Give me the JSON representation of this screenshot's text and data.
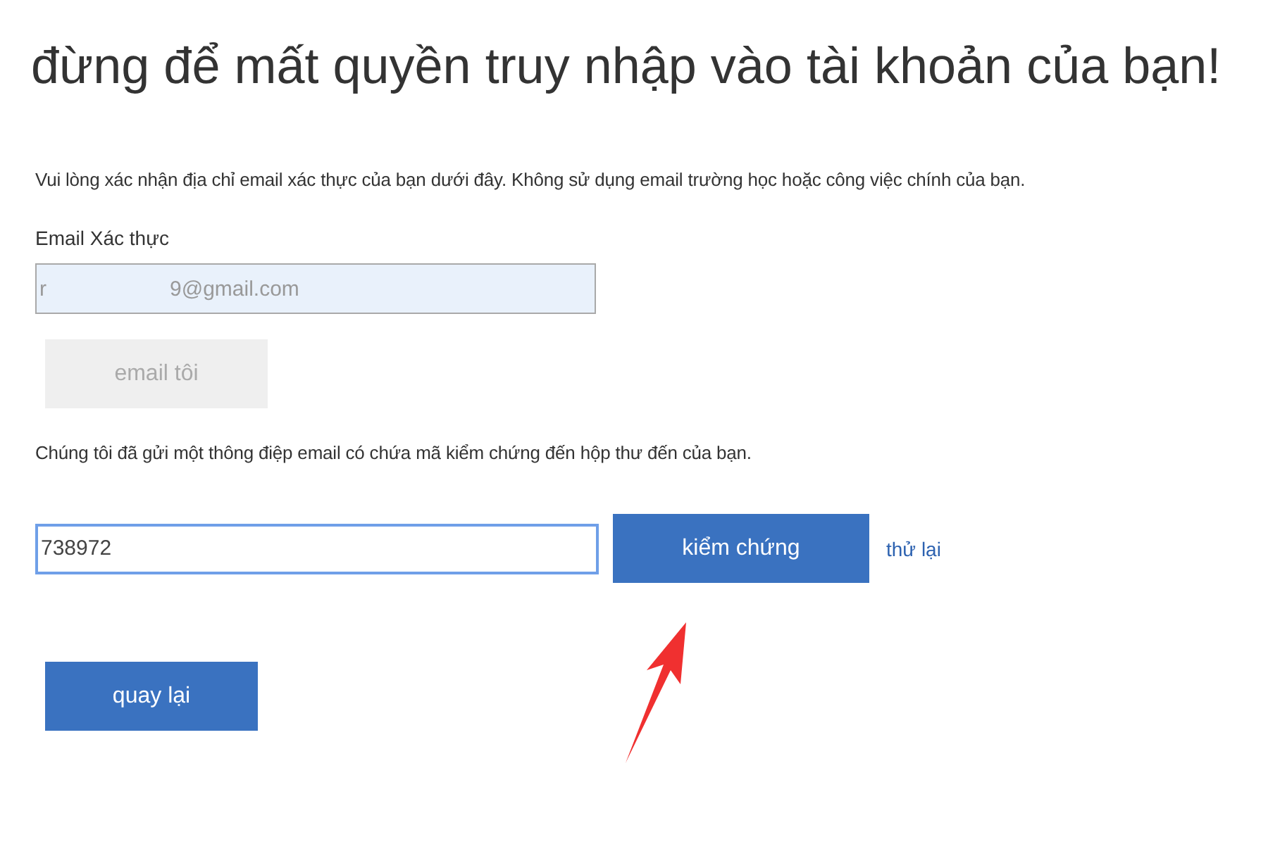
{
  "title": "đừng để mất quyền truy nhập vào tài khoản của bạn!",
  "instructions": "Vui lòng xác nhận địa chỉ email xác thực của bạn dưới đây. Không sử dụng email trường học hoặc công việc chính của bạn.",
  "email_field": {
    "label": "Email Xác thực",
    "value": "r                     9@gmail.com",
    "disabled": true
  },
  "email_me_button": {
    "label": "email tôi",
    "disabled": true
  },
  "sent_message": "Chúng tôi đã gửi một thông điệp email có chứa mã kiểm chứng đến hộp thư đến của bạn.",
  "code_field": {
    "value": "738972",
    "focused": true
  },
  "verify_button": {
    "label": "kiểm chứng"
  },
  "retry_link": "thử lại",
  "back_button": {
    "label": "quay lại"
  }
}
